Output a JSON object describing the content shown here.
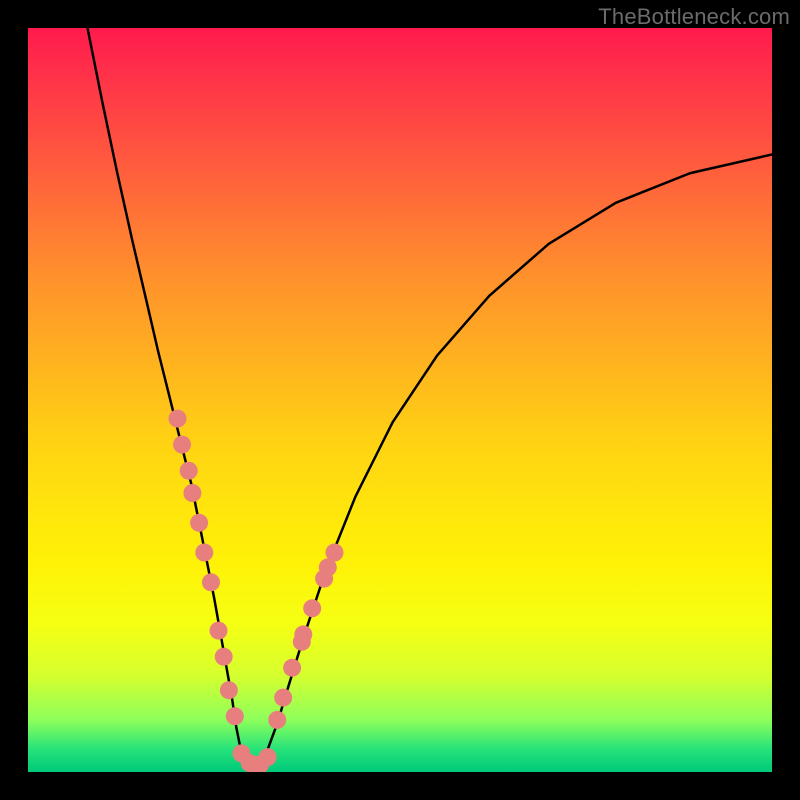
{
  "watermark": "TheBottleneck.com",
  "colors": {
    "curve_stroke": "#000000",
    "dot_fill": "#e87f7f",
    "dot_stroke": "#b84f4f"
  },
  "chart_data": {
    "type": "line",
    "title": "",
    "xlabel": "",
    "ylabel": "",
    "xlim": [
      0,
      100
    ],
    "ylim": [
      0,
      100
    ],
    "grid": false,
    "series": [
      {
        "name": "curve",
        "x": [
          8,
          10,
          12,
          14,
          16,
          17.5,
          19,
          20.5,
          22,
          23,
          24,
          25,
          25.8,
          26.6,
          27.4,
          28,
          28.6,
          29.2,
          29.8,
          30.5,
          31.3,
          32.2,
          33.5,
          35,
          37,
          40,
          44,
          49,
          55,
          62,
          70,
          79,
          89,
          100
        ],
        "y": [
          100,
          90,
          80.5,
          71.5,
          63,
          56.5,
          50.5,
          44.5,
          38.5,
          33.5,
          28.5,
          23.5,
          19,
          14.5,
          10,
          6,
          3,
          1,
          0.5,
          0.5,
          1.2,
          3,
          6.5,
          11.5,
          18,
          27,
          37,
          47,
          56,
          64,
          71,
          76.5,
          80.5,
          83
        ]
      }
    ],
    "dots_left": [
      {
        "x": 20.1,
        "y": 47.5
      },
      {
        "x": 20.7,
        "y": 44.0
      },
      {
        "x": 21.6,
        "y": 40.5
      },
      {
        "x": 22.1,
        "y": 37.5
      },
      {
        "x": 23.0,
        "y": 33.5
      },
      {
        "x": 23.7,
        "y": 29.5
      },
      {
        "x": 24.6,
        "y": 25.5
      },
      {
        "x": 25.6,
        "y": 19.0
      },
      {
        "x": 26.3,
        "y": 15.5
      },
      {
        "x": 27.0,
        "y": 11.0
      },
      {
        "x": 27.8,
        "y": 7.5
      }
    ],
    "dots_right": [
      {
        "x": 33.5,
        "y": 7.0
      },
      {
        "x": 34.3,
        "y": 10.0
      },
      {
        "x": 35.5,
        "y": 14.0
      },
      {
        "x": 36.8,
        "y": 17.5
      },
      {
        "x": 37.0,
        "y": 18.5
      },
      {
        "x": 38.2,
        "y": 22.0
      },
      {
        "x": 39.8,
        "y": 26.0
      },
      {
        "x": 40.3,
        "y": 27.5
      },
      {
        "x": 41.2,
        "y": 29.5
      }
    ],
    "dots_bottom": [
      {
        "x": 28.7,
        "y": 2.5
      },
      {
        "x": 29.8,
        "y": 1.2
      },
      {
        "x": 30.4,
        "y": 1.0
      },
      {
        "x": 31.2,
        "y": 1.0
      },
      {
        "x": 32.2,
        "y": 2.0
      }
    ]
  }
}
